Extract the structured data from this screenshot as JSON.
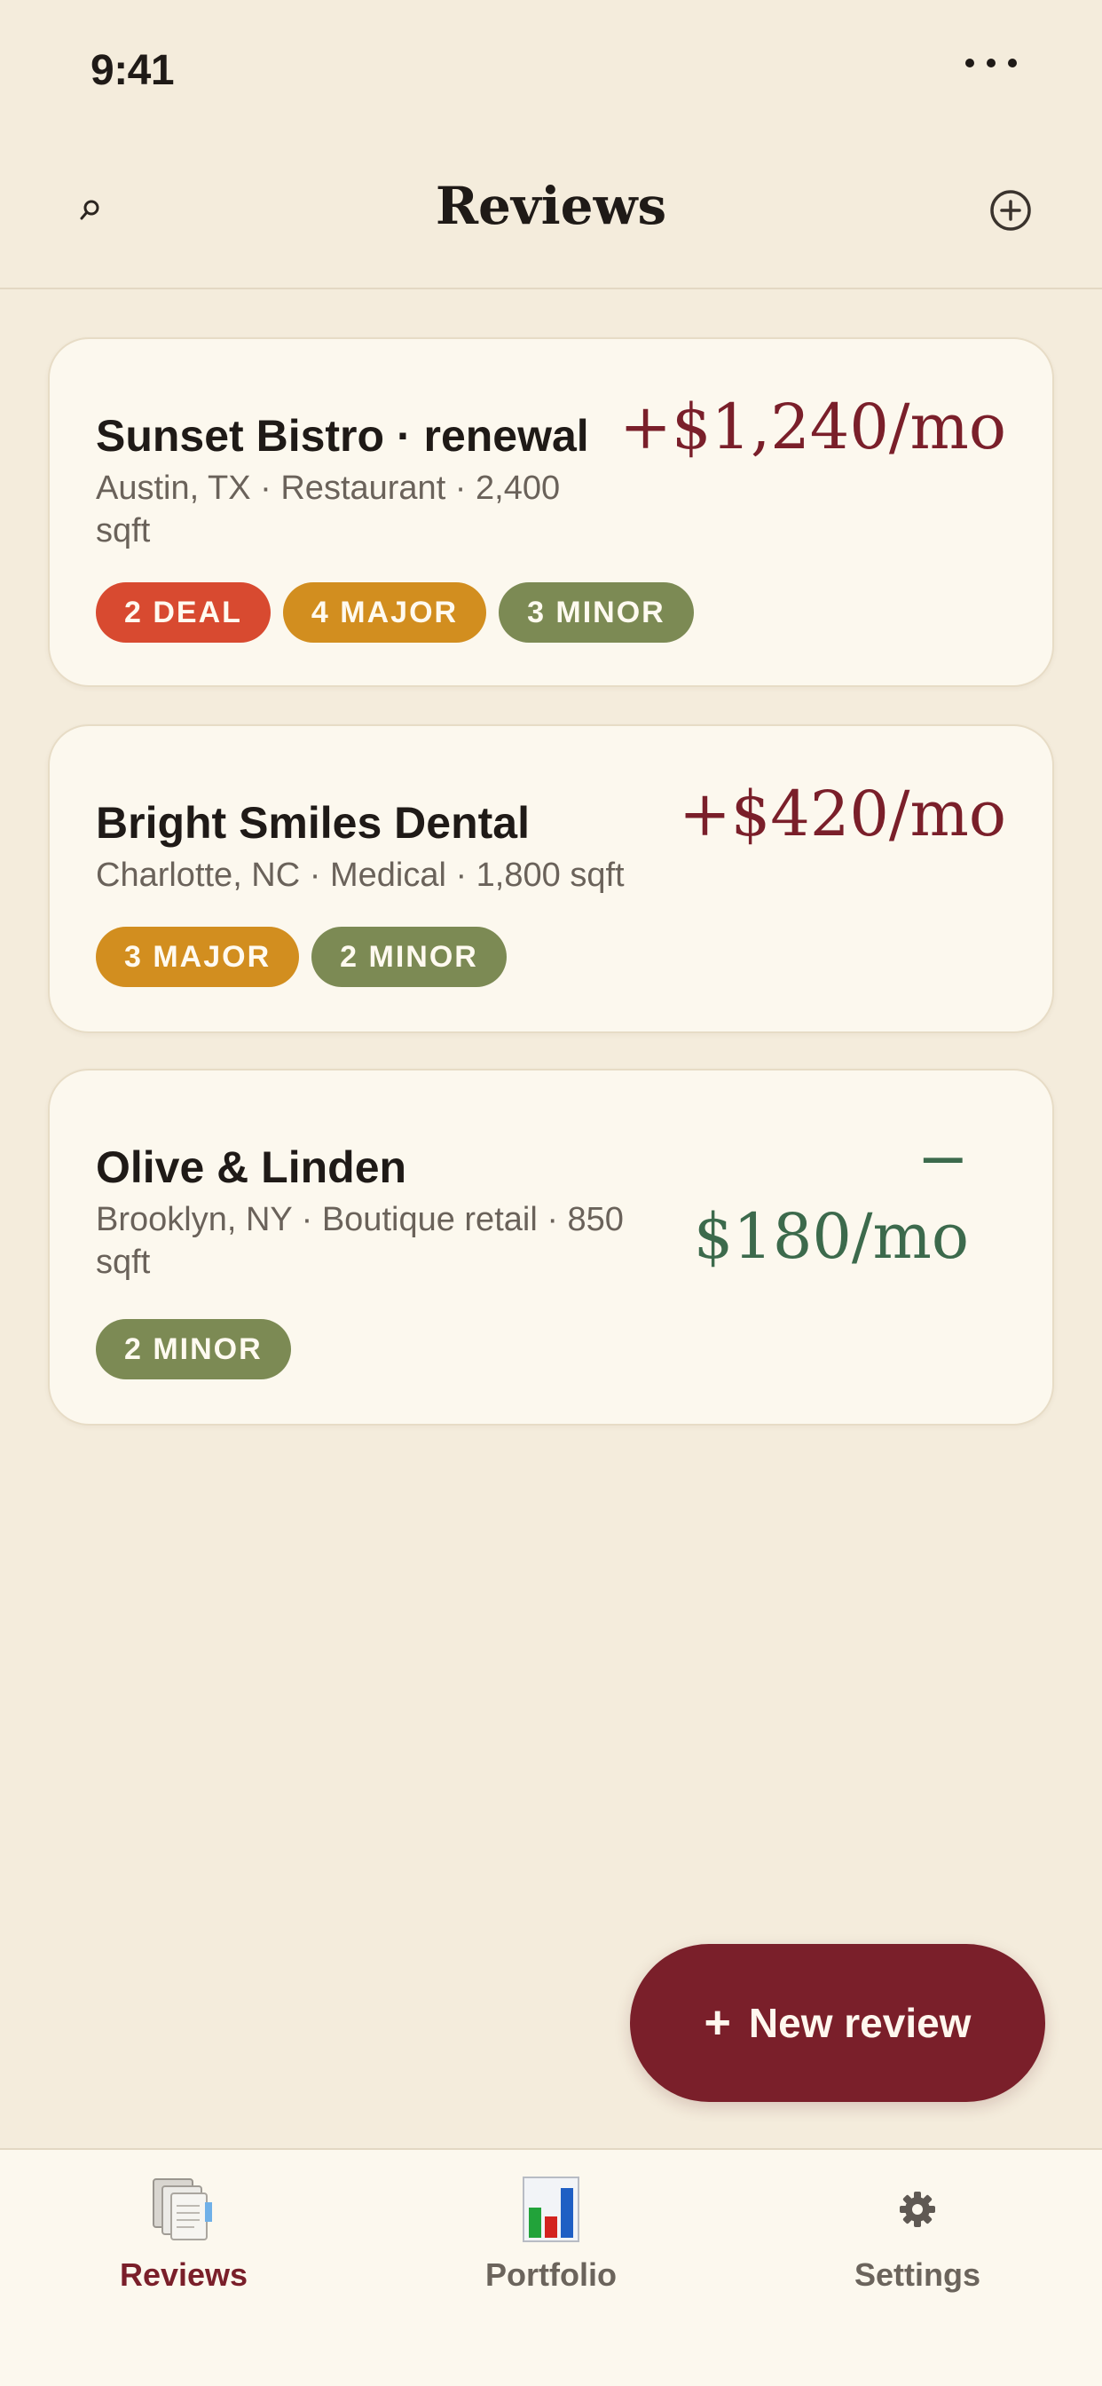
{
  "status": {
    "time": "9:41"
  },
  "nav": {
    "title": "Reviews"
  },
  "cards": [
    {
      "title": "Sunset Bistro · renewal",
      "subtitle": "Austin, TX · Restaurant · 2,400 sqft",
      "amount": "+$1,240/mo",
      "tags": [
        "2 DEAL",
        "4 MAJOR",
        "3 MINOR"
      ]
    },
    {
      "title": "Bright Smiles Dental",
      "subtitle": "Charlotte, NC · Medical · 1,800 sqft",
      "amount": "+$420/mo",
      "tags": [
        "3 MAJOR",
        "2 MINOR"
      ]
    },
    {
      "title": "Olive & Linden",
      "subtitle": "Brooklyn, NY · Boutique retail · 850 sqft",
      "amount_sign": "−",
      "amount": "$180/mo",
      "tags": [
        "2 MINOR"
      ]
    }
  ],
  "fab": {
    "plus": "+",
    "label": "New review"
  },
  "tabs": [
    {
      "label": "Reviews",
      "icon": "document-stack-icon",
      "active": true
    },
    {
      "label": "Portfolio",
      "icon": "bar-chart-icon",
      "active": false
    },
    {
      "label": "Settings",
      "icon": "gear-icon",
      "active": false
    }
  ],
  "colors": {
    "background": "#f4ecdc",
    "card": "#fcf8ee",
    "accent": "#7a1f2a",
    "positive": "#3c6a4c",
    "deal": "#d84a30",
    "major": "#d28e1f",
    "minor": "#7c8a54"
  }
}
